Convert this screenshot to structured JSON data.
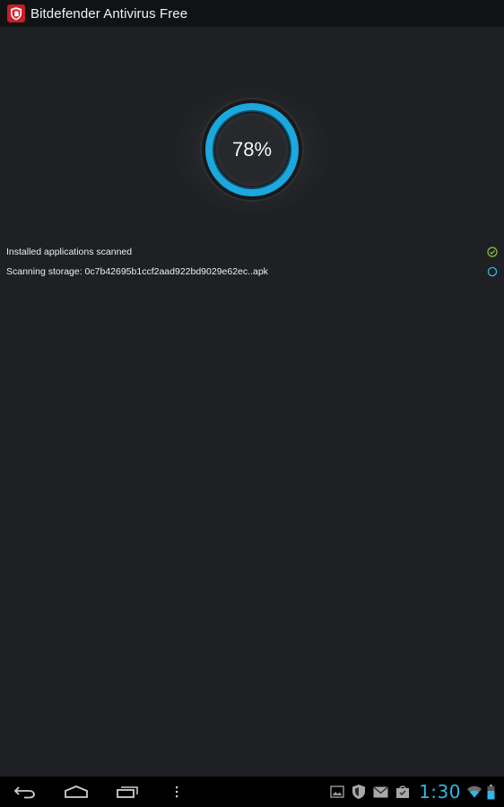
{
  "app": {
    "title": "Bitdefender Antivirus Free",
    "icon": "bitdefender-shield-icon"
  },
  "scan": {
    "progress_percent": 78,
    "progress_label": "78%"
  },
  "status": {
    "items": [
      {
        "label": "Installed applications scanned",
        "state": "done",
        "icon": "check-circle-icon"
      },
      {
        "label": "Scanning storage: 0c7b42695b1ccf2aad922bd9029e62ec..apk",
        "state": "in-progress",
        "icon": "ring-icon"
      }
    ]
  },
  "system_bar": {
    "clock": "1:30",
    "nav_icons": [
      "back-icon",
      "home-icon",
      "recent-apps-icon",
      "menu-icon"
    ],
    "notification_icons": [
      "gallery-icon",
      "shield-icon",
      "mail-icon",
      "store-bag-icon",
      "wifi-icon",
      "battery-icon"
    ]
  },
  "colors": {
    "accent": "#33b5e5",
    "ring": "#1aa8de",
    "success": "#8bc34a",
    "brand_red": "#d9262d",
    "background": "#1f2023"
  }
}
